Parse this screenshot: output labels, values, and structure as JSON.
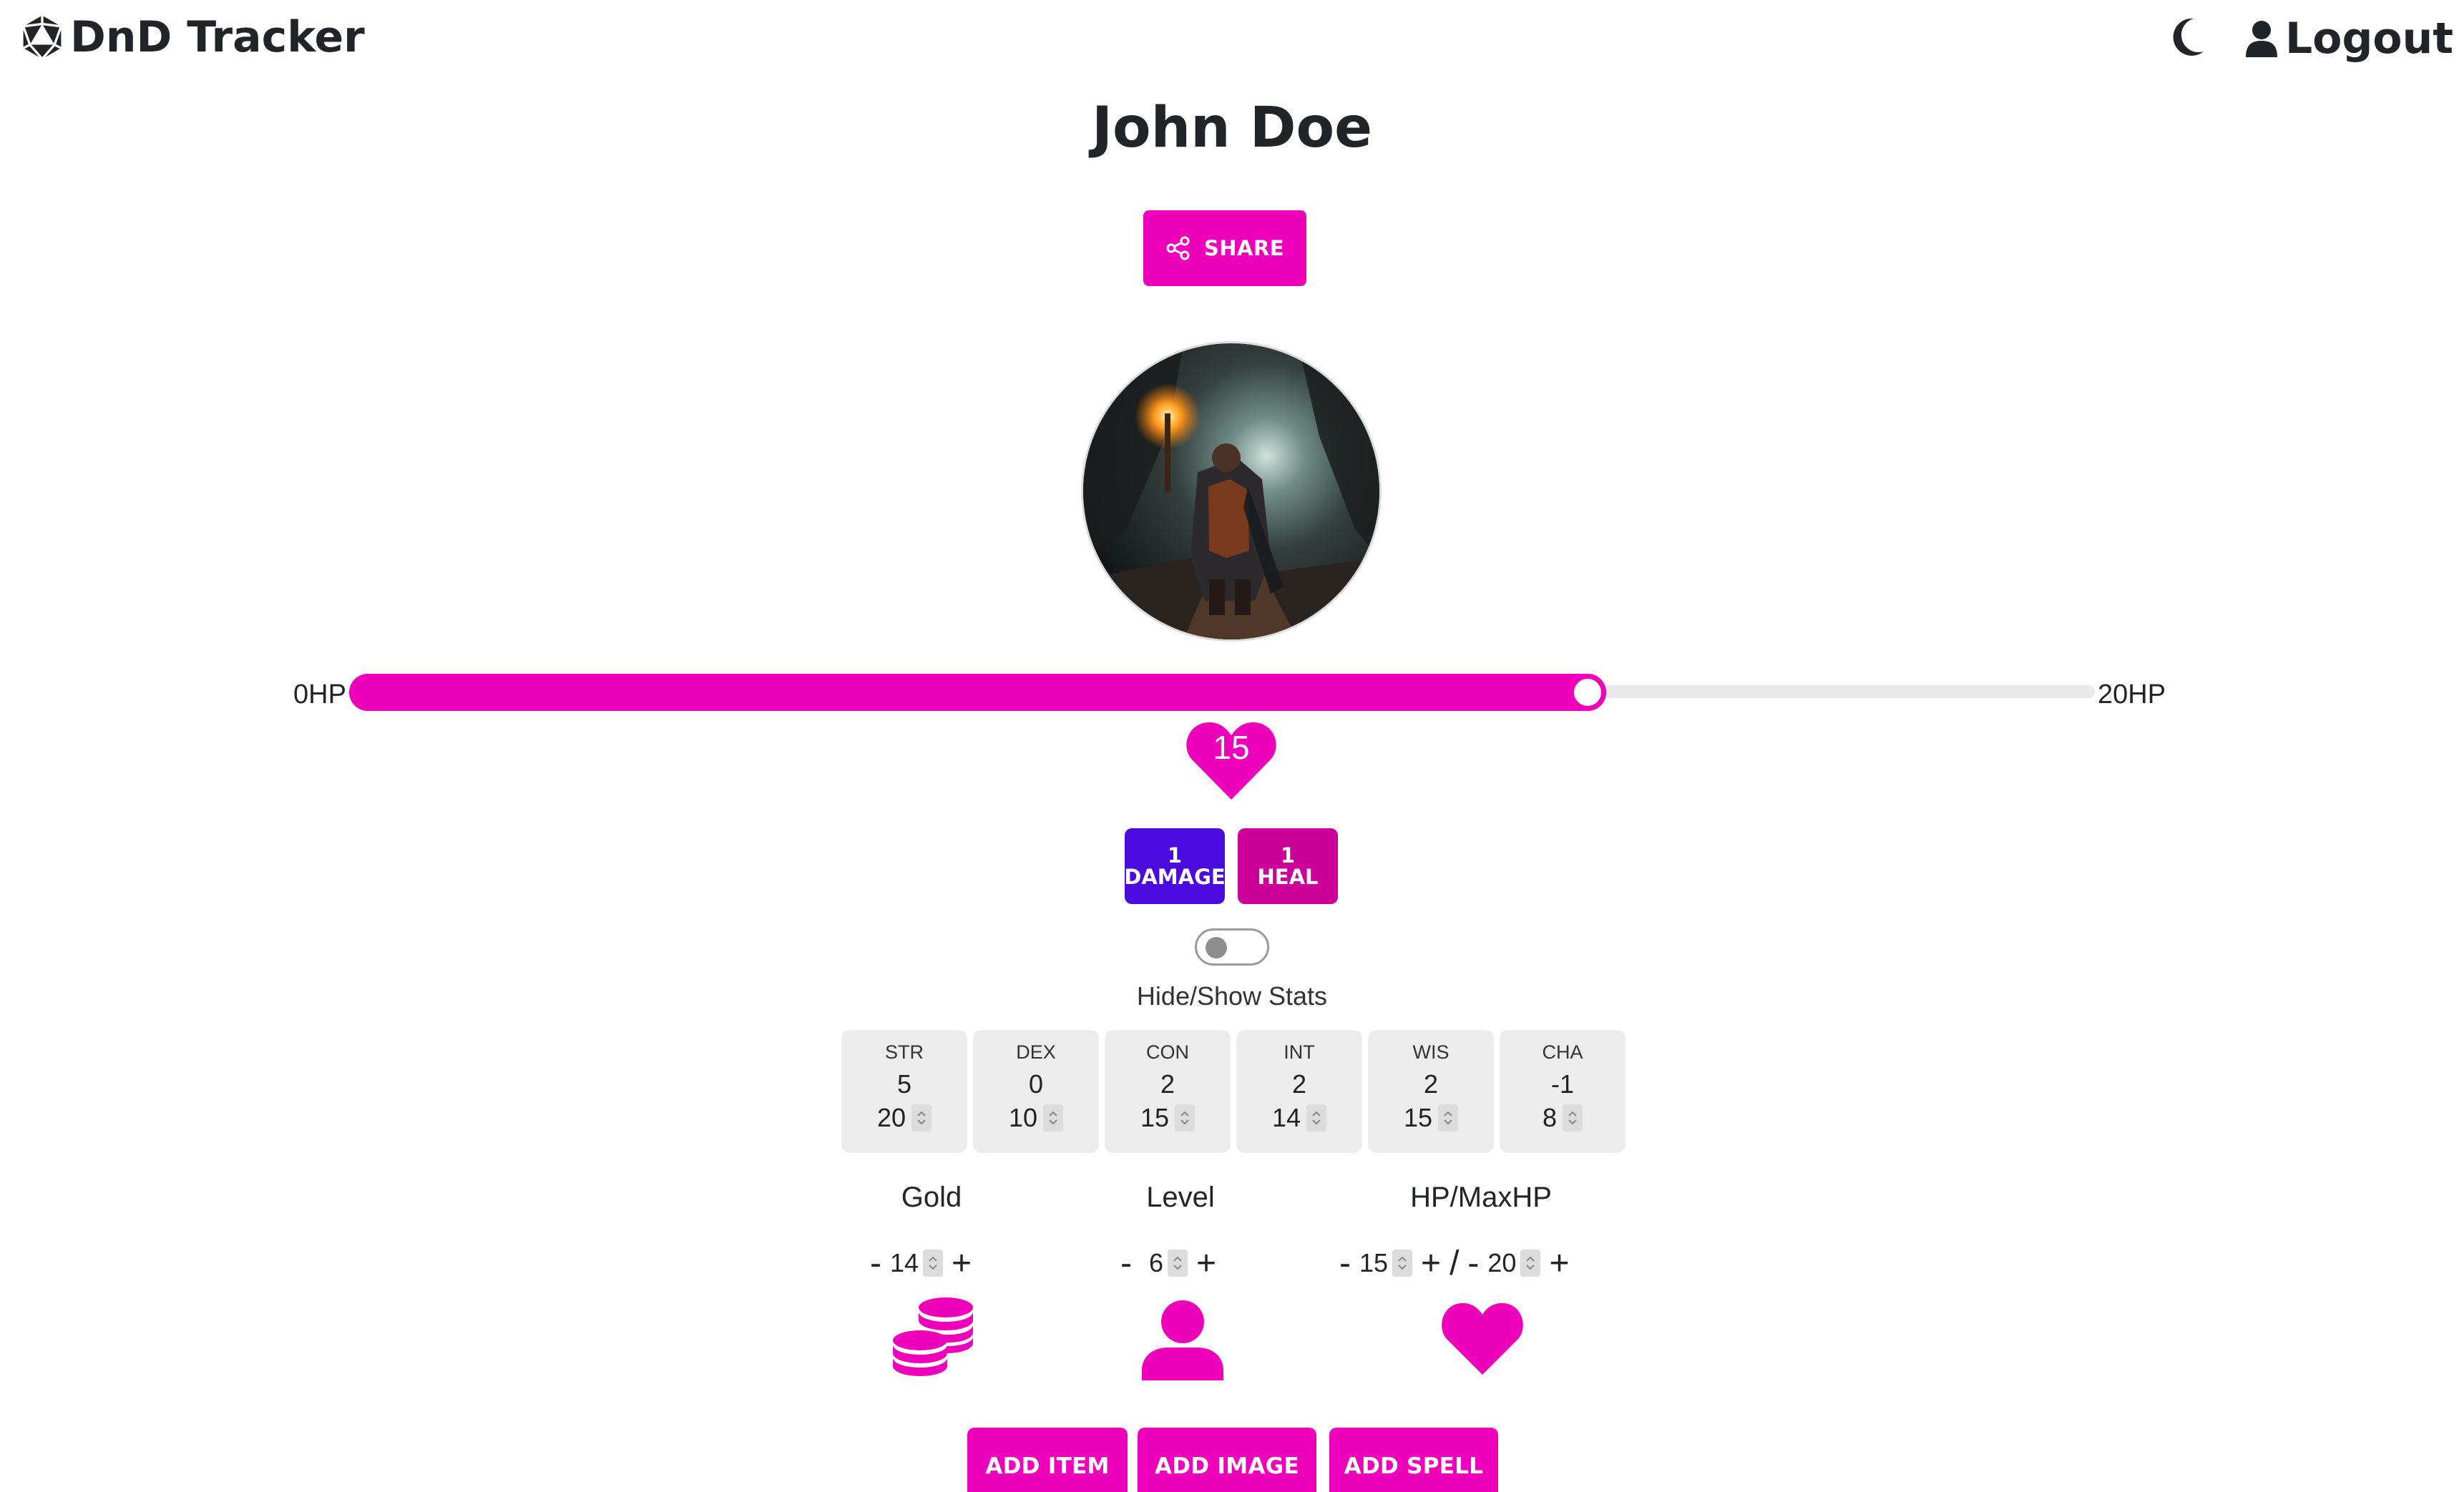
{
  "header": {
    "brand": "DnD Tracker",
    "logout_label": "Logout"
  },
  "character": {
    "name": "John Doe"
  },
  "share": {
    "label": "SHARE"
  },
  "hp_bar": {
    "min_label": "0HP",
    "max_label": "20HP",
    "current": 15,
    "max": 20,
    "current_label": "15"
  },
  "actions": {
    "damage": {
      "amount": "1",
      "label": "DAMAGE"
    },
    "heal": {
      "amount": "1",
      "label": "HEAL"
    }
  },
  "stats_toggle": {
    "label": "Hide/Show Stats",
    "on": false
  },
  "stats": [
    {
      "name": "STR",
      "mod": "5",
      "score": "20"
    },
    {
      "name": "DEX",
      "mod": "0",
      "score": "10"
    },
    {
      "name": "CON",
      "mod": "2",
      "score": "15"
    },
    {
      "name": "INT",
      "mod": "2",
      "score": "14"
    },
    {
      "name": "WIS",
      "mod": "2",
      "score": "15"
    },
    {
      "name": "CHA",
      "mod": "-1",
      "score": "8"
    }
  ],
  "counters": {
    "gold": {
      "label": "Gold",
      "value": "14"
    },
    "level": {
      "label": "Level",
      "value": "6"
    },
    "hp": {
      "label": "HP/MaxHP",
      "value": "15",
      "max_value": "20",
      "separator": "/"
    },
    "minus": "-",
    "plus": "+"
  },
  "bottom_buttons": {
    "add_item": "ADD ITEM",
    "add_image": "ADD IMAGE",
    "add_spell": "ADD SPELL"
  },
  "colors": {
    "primary": "#ee00bb",
    "damage": "#4b0bdc",
    "heal": "#cc0099",
    "text": "#212529"
  },
  "icons": {
    "brand": "d20-icon",
    "theme": "moon-icon",
    "user": "user-icon",
    "share": "share-icon",
    "gold": "coins-icon",
    "level": "person-icon",
    "hp": "heart-icon"
  }
}
